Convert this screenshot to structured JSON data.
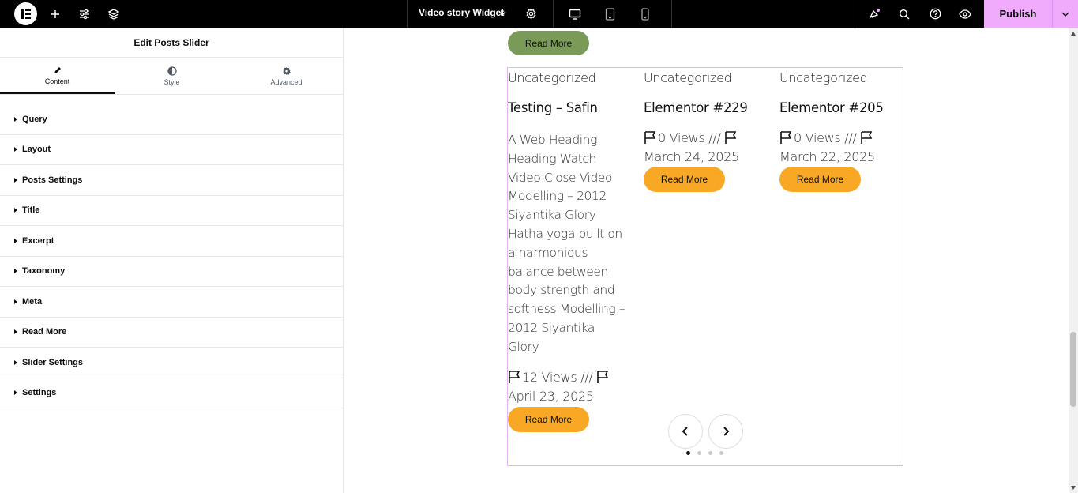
{
  "topbar": {
    "document_title": "Video story Widget",
    "publish_label": "Publish",
    "icons": [
      "elementor-logo-icon",
      "plus-icon",
      "sliders-icon",
      "layers-icon",
      "gear-icon",
      "desktop-icon",
      "tablet-icon",
      "mobile-icon",
      "notifications-icon",
      "search-icon",
      "help-icon",
      "eye-icon",
      "chevron-down-icon"
    ]
  },
  "panel": {
    "title": "Edit Posts Slider",
    "tabs": [
      {
        "label": "Content",
        "icon": "pencil-icon"
      },
      {
        "label": "Style",
        "icon": "half-circle-icon"
      },
      {
        "label": "Advanced",
        "icon": "gear-icon"
      }
    ],
    "sections": [
      "Query",
      "Layout",
      "Posts Settings",
      "Title",
      "Excerpt",
      "Taxonomy",
      "Meta",
      "Read More",
      "Slider Settings",
      "Settings"
    ]
  },
  "canvas": {
    "top_button": "Read More",
    "posts": [
      {
        "category": "Uncategorized",
        "title": "Testing – Safin",
        "excerpt": "A Web Heading Heading Watch Video Close Video Modelling – 2012 Siyantika Glory Hatha yoga built on a harmonious balance between body strength and softness Modelling – 2012 Siyantika Glory",
        "views": "12 Views ///",
        "date": "April 23, 2025",
        "button": "Read More"
      },
      {
        "category": "Uncategorized",
        "title": "Elementor #229",
        "excerpt": "",
        "views": "0 Views ///",
        "date": "March 24, 2025",
        "button": "Read More"
      },
      {
        "category": "Uncategorized",
        "title": "Elementor #205",
        "excerpt": "",
        "views": "0 Views ///",
        "date": "March 22, 2025",
        "button": "Read More"
      }
    ],
    "pagination": {
      "total": 4,
      "active": 1
    }
  },
  "colors": {
    "publish": "#f0abfc",
    "read_more": "#f9a826",
    "read_more_top": "#7a9a57",
    "selection_border": "#e7b5f5"
  }
}
